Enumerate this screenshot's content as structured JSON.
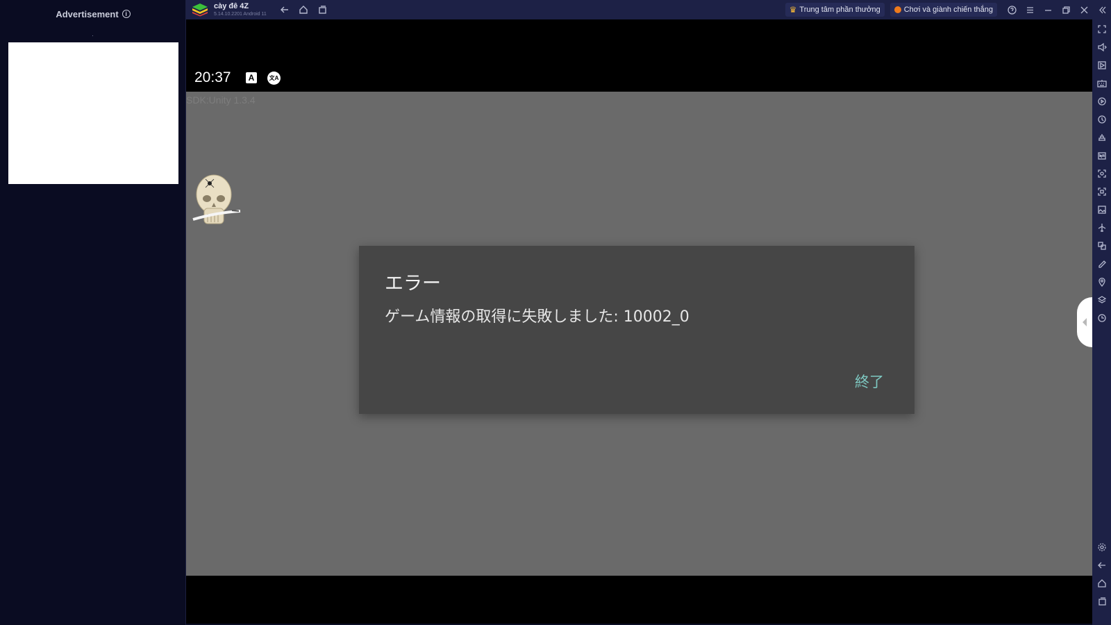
{
  "ad_panel": {
    "header": "Advertisement",
    "info_icon": "i"
  },
  "titlebar": {
    "app_name": "cày đê 4Z",
    "app_version": "5.14.10.2201  Android 11",
    "reward_center_label": "Trung tâm phần thưởng",
    "play_win_label": "Chơi và giành chiến thắng",
    "crown_icon": "♛"
  },
  "status_bar": {
    "time": "20:37",
    "a_icon": "A",
    "translate_icon": "文A"
  },
  "game": {
    "sdk_label": "SDK:Unity 1.3.4"
  },
  "dialog": {
    "title": "エラー",
    "message": "ゲーム情報の取得に失敗しました: 10002_0",
    "exit_button": "終了"
  },
  "colors": {
    "accent": "#7ec9c2",
    "chrome_bg": "#1d2146",
    "game_bg": "#6a6a6a",
    "dialog_bg": "#464646"
  }
}
